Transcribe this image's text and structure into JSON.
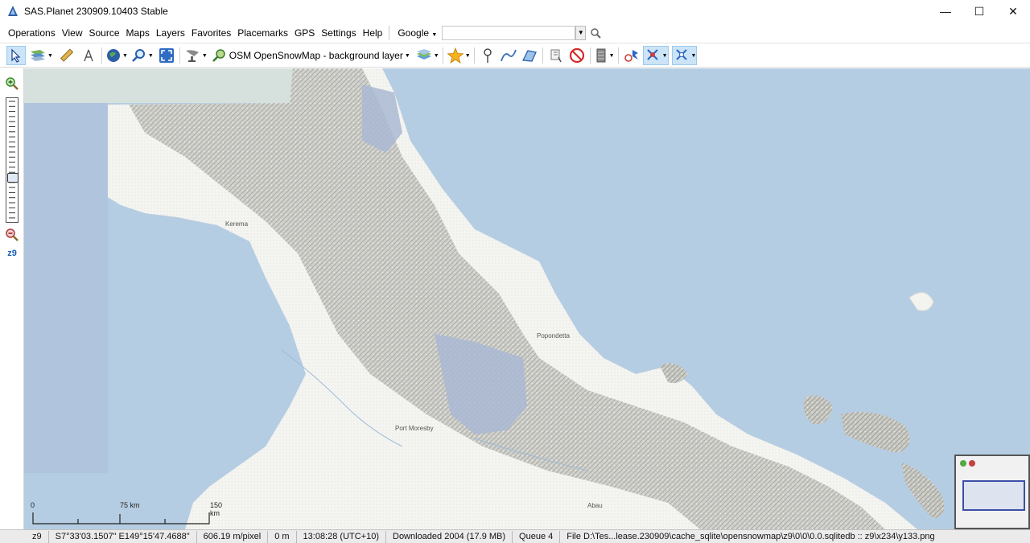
{
  "window": {
    "title": "SAS.Planet 230909.10403 Stable",
    "icon": "sasplanet-app-icon",
    "controls": [
      "—",
      "☐",
      "✕"
    ]
  },
  "menu": {
    "items": [
      "Operations",
      "View",
      "Source",
      "Maps",
      "Layers",
      "Favorites",
      "Placemarks",
      "GPS",
      "Settings",
      "Help"
    ],
    "search_provider": "Google",
    "search_value": ""
  },
  "toolbar": {
    "current_map": "OSM OpenSnowMap - background layer",
    "icons": [
      "cursor-icon",
      "map-sheets-icon",
      "ruler-icon",
      "compass-icon",
      "globe-icon",
      "magnifier-icon",
      "fullscreen-icon",
      "satellite-dish-icon",
      "map-source-icon",
      "layers-icon",
      "favorite-star-icon",
      "placemark-pin-icon",
      "path-icon",
      "polygon-icon",
      "marks-visibility-icon",
      "marks-hide-icon",
      "cache-storage-icon",
      "gps-connect-icon",
      "gps-track-icon",
      "gps-center-icon"
    ]
  },
  "zoom": {
    "level": "z9",
    "in_icon": "zoom-in-icon",
    "out_icon": "zoom-out-icon"
  },
  "map": {
    "places": [
      "Kerema",
      "Popondetta",
      "Port Moresby",
      "Abau"
    ],
    "scale_labels": [
      "0",
      "75 km",
      "150 km"
    ],
    "colors": {
      "sea": "#b5cde2",
      "land": "#f3f3f0",
      "relief": "#b9b9b4",
      "overlay": "#a9b9d3"
    }
  },
  "status": {
    "zoom": "z9",
    "coordinates": "S7°33'03.1507\" E149°15'47.4688\"",
    "resolution": "606.19 m/pixel",
    "altitude": "0 m",
    "time": "13:08:28 (UTC+10)",
    "downloaded": "Downloaded 2004 (17.9 MB)",
    "queue": "Queue 4",
    "file": "File D:\\Tes...lease.230909\\cache_sqlite\\opensnowmap\\z9\\0\\0\\0.0.sqlitedb :: z9\\x234\\y133.png"
  }
}
